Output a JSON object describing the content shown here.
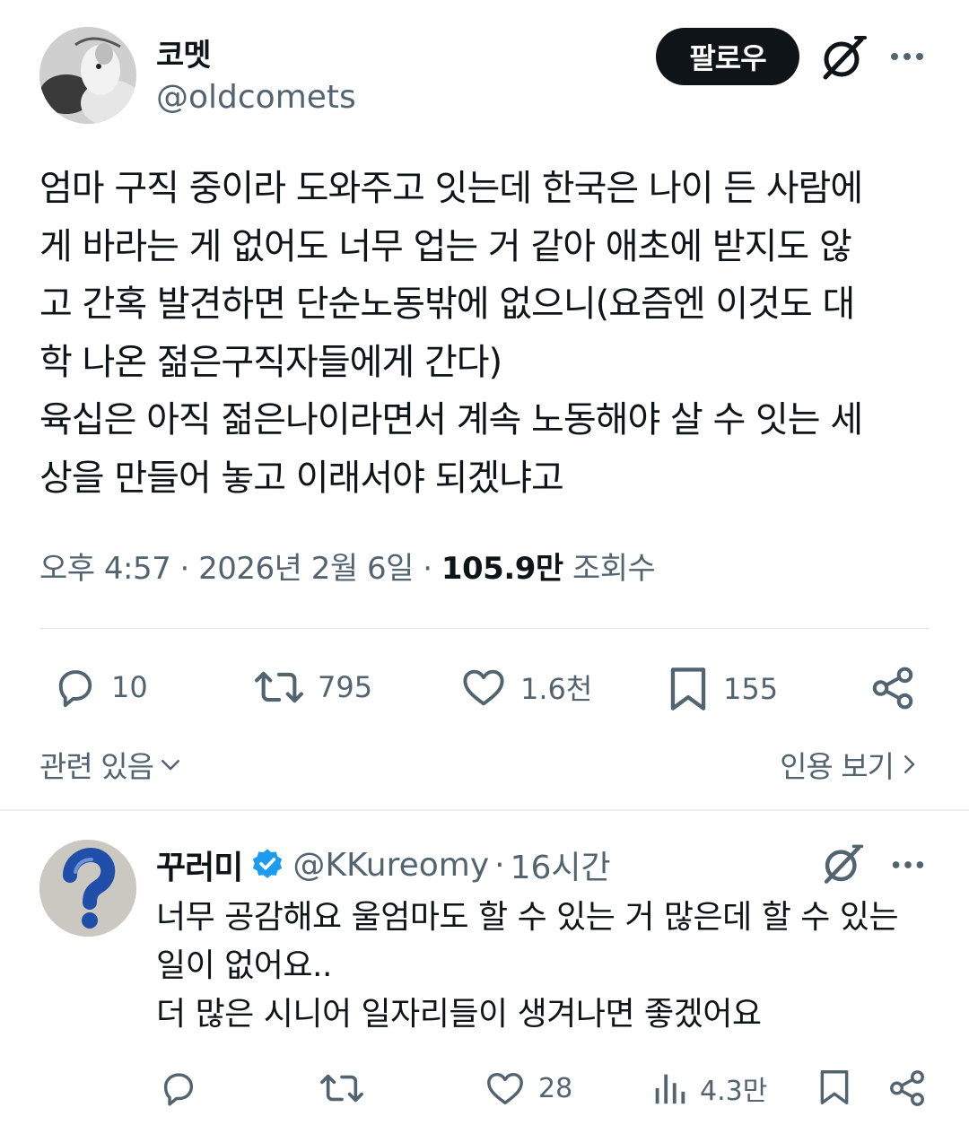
{
  "post": {
    "author": {
      "name": "코멧",
      "handle": "@oldcomets"
    },
    "follow_label": "팔로우",
    "text_lines": [
      "엄마 구직 중이라 도와주고 잇는데 한국은 나이 든 사람에",
      "게 바라는 게 없어도 너무 업는 거 같아 애초에 받지도 않",
      "고 간혹 발견하면 단순노동밖에 없으니(요즘엔 이것도 대",
      "학 나온 젊은구직자들에게 간다)",
      "육십은 아직 젊은나이라면서 계속 노동해야 살 수 잇는 세",
      "상을 만들어 놓고 이래서야 되겠냐고"
    ],
    "time": "오후 4:57",
    "date": "2026년 2월 6일",
    "views_count": "105.9만",
    "views_label": "조회수",
    "actions": {
      "replies": "10",
      "reposts": "795",
      "likes": "1.6천",
      "bookmarks": "155"
    },
    "related_label": "관련 있음",
    "quotes_label": "인용 보기"
  },
  "reply": {
    "author": {
      "name": "꾸러미",
      "handle": "@KKureomy",
      "time": "16시간"
    },
    "text_lines": [
      "너무 공감해요 울엄마도 할 수 있는 거 많은데 할 수 있는",
      "일이 없어요..",
      "더 많은 시니어 일자리들이 생겨나면 좋겠어요"
    ],
    "actions": {
      "likes": "28",
      "views": "4.3만"
    }
  },
  "colors": {
    "text": "#0f1419",
    "secondary": "#536471",
    "verified": "#1d9bf0",
    "divider": "#e4e7ea"
  },
  "icons": [
    "grok-icon",
    "more-icon",
    "reply-icon",
    "repost-icon",
    "like-icon",
    "bookmark-icon",
    "share-icon",
    "views-icon",
    "verified-badge-icon",
    "chevron-down-icon",
    "chevron-right-icon"
  ]
}
